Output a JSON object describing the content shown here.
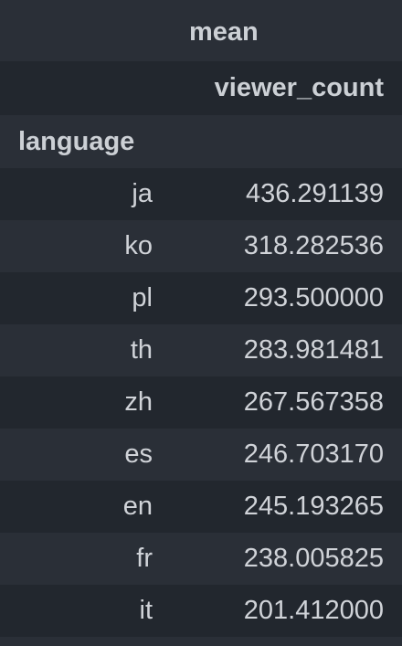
{
  "table": {
    "header_top": "mean",
    "header_mid": "viewer_count",
    "index_name": "language",
    "rows": [
      {
        "language": "ja",
        "value": "436.291139"
      },
      {
        "language": "ko",
        "value": "318.282536"
      },
      {
        "language": "pl",
        "value": "293.500000"
      },
      {
        "language": "th",
        "value": "283.981481"
      },
      {
        "language": "zh",
        "value": "267.567358"
      },
      {
        "language": "es",
        "value": "246.703170"
      },
      {
        "language": "en",
        "value": "245.193265"
      },
      {
        "language": "fr",
        "value": "238.005825"
      },
      {
        "language": "it",
        "value": "201.412000"
      }
    ]
  }
}
